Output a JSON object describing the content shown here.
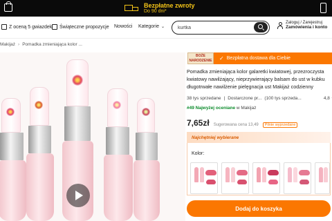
{
  "topbar": {
    "promo_title": "Bezpłatne zwroty",
    "promo_subtitle": "Do 90 dni*",
    "accent": "#f5c518"
  },
  "nav": {
    "items": [
      {
        "label": "Z oceną 5 gwiazdek",
        "icon": "thumbs-up-icon"
      },
      {
        "label": "Świąteczne propozycje",
        "icon": "gift-icon"
      },
      {
        "label": "Nowości",
        "icon": ""
      },
      {
        "label": "Kategorie",
        "icon": "chevron-down-icon"
      }
    ],
    "search_value": "kurtka",
    "account_line1": "Zaloguj / Zarejestruj",
    "account_line2": "Zamówienia i konto"
  },
  "breadcrumb": {
    "items": [
      "Makijaż",
      "Pomadka zmieniająca kolor ..."
    ]
  },
  "product": {
    "holiday_badge": "BOŻE NARODZENIE",
    "shipping_badge": "Bezpłatna dostawa dla Ciebie",
    "title": "Pomadka zmieniająca kolor galaretki kwiatowej, przezroczysta kwiatowy nawilżający, nieprzywierający balsam do ust w kubku długotrwałe nawilżenie pielęgnacja ust Makijaż codzienny",
    "sold": "38 tys sprzedane",
    "sold_by": "Dostarczone pr...",
    "reviews": "(100 tys sprzeda...",
    "rating": "4,8",
    "rank_highlight": "#49 Najwyżej oceniane",
    "rank_category": "w Makijaż",
    "price": "7,65zł",
    "old_price": "Sugerowana cena 13,49",
    "deal_label": "Pilnie wyprzedane",
    "best_label": "Najchętniej wybierane",
    "color_label": "Kolor:",
    "add_to_cart": "Dodaj do koszyka",
    "brand_color": "#fb7701"
  }
}
